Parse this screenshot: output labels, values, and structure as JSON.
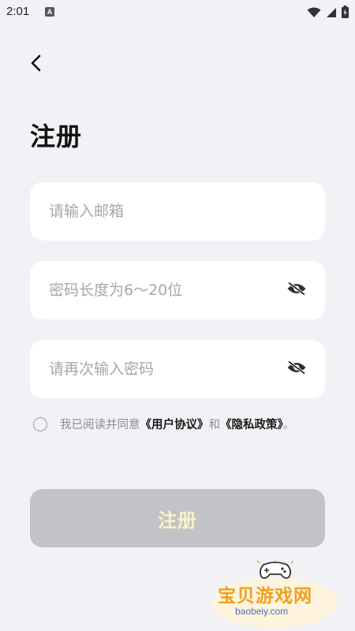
{
  "status_bar": {
    "time": "2:01",
    "app_icon_letter": "A"
  },
  "header": {
    "title": "注册"
  },
  "form": {
    "email": {
      "value": "",
      "placeholder": "请输入邮箱"
    },
    "password": {
      "value": "",
      "placeholder": "密码长度为6～20位"
    },
    "confirm_password": {
      "value": "",
      "placeholder": "请再次输入密码"
    }
  },
  "agreement": {
    "prefix": "我已阅读并同意",
    "user_agreement": "《用户协议》",
    "conjunction": "和",
    "privacy_policy": "《隐私政策》",
    "suffix": "。"
  },
  "submit": {
    "label": "注册"
  },
  "watermark": {
    "title": "宝贝游戏网",
    "domain": "baobeiy.com"
  },
  "colors": {
    "background": "#f2f2f6",
    "field_bg": "#ffffff",
    "button_disabled": "#c3c3c7",
    "button_text": "#fbf1c9"
  }
}
